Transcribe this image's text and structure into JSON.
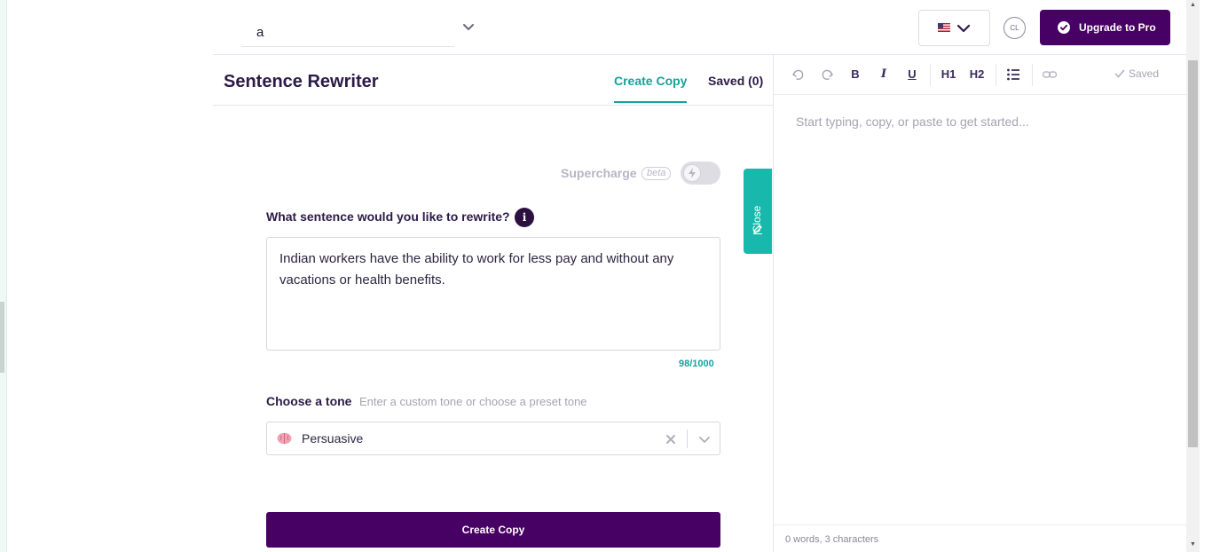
{
  "topbar": {
    "project_value": "a",
    "avatar_initials": "CL",
    "upgrade_label": "Upgrade to Pro",
    "language_flag": "us-flag"
  },
  "panel": {
    "title": "Sentence Rewriter",
    "tabs": [
      {
        "label": "Create Copy",
        "active": true
      },
      {
        "label": "Saved (0)",
        "active": false
      }
    ]
  },
  "supercharge": {
    "label": "Supercharge",
    "badge": "beta",
    "enabled": false
  },
  "close_tab": {
    "label": "Close"
  },
  "form": {
    "sentence_label": "What sentence would you like to rewrite?",
    "info_icon": "i",
    "sentence_value": "Indian workers have the ability to work for less pay and without any vacations or health benefits.",
    "char_count": "98/1000",
    "tone_label": "Choose a tone",
    "tone_hint": "Enter a custom tone or choose a preset tone",
    "tone_value": "Persuasive",
    "tone_icon": "brain-icon",
    "submit_label": "Create Copy"
  },
  "editor": {
    "toolbar": {
      "h1": "H1",
      "h2": "H2",
      "bold": "B",
      "italic": "I",
      "underline": "U"
    },
    "saved_label": "Saved",
    "placeholder": "Start typing, copy, or paste to get started...",
    "word_count": "0 words, 3 characters"
  },
  "colors": {
    "primary": "#470063",
    "accent": "#14a39a",
    "close_tab": "#19b8ac"
  }
}
